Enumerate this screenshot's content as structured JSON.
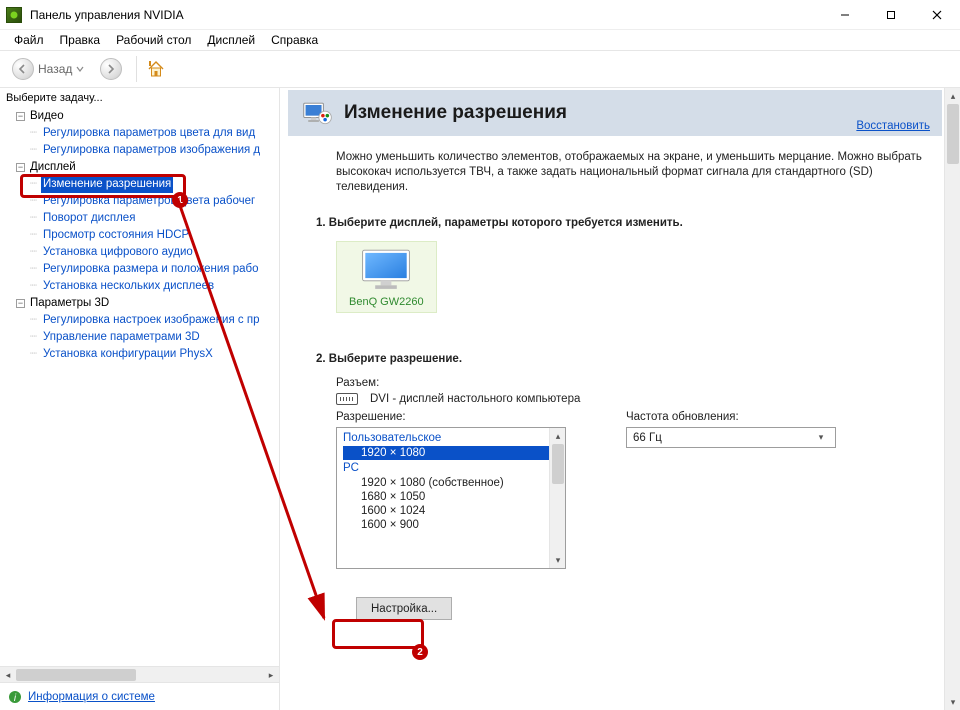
{
  "window": {
    "title": "Панель управления NVIDIA"
  },
  "menu": {
    "file": "Файл",
    "edit": "Правка",
    "desktop": "Рабочий стол",
    "display": "Дисплей",
    "help": "Справка"
  },
  "toolbar": {
    "back": "Назад"
  },
  "sidebar": {
    "task_label": "Выберите задачу...",
    "cat_video": "Видео",
    "video_items": {
      "i0": "Регулировка параметров цвета для вид",
      "i1": "Регулировка параметров изображения д"
    },
    "cat_display": "Дисплей",
    "display_items": {
      "i0": "Изменение разрешения",
      "i1": "Регулировка параметров цвета рабочег",
      "i2": "Поворот дисплея",
      "i3": "Просмотр состояния HDCP",
      "i4": "Установка цифрового аудио",
      "i5": "Регулировка размера и положения рабо",
      "i6": "Установка нескольких дисплеев"
    },
    "cat_3d": "Параметры 3D",
    "d3_items": {
      "i0": "Регулировка настроек изображения с пр",
      "i1": "Управление параметрами 3D",
      "i2": "Установка конфигурации PhysX"
    },
    "sysinfo": "Информация о системе"
  },
  "page": {
    "title": "Изменение разрешения",
    "restore": "Восстановить",
    "intro": "Можно уменьшить количество элементов, отображаемых на экране, и уменьшить мерцание. Можно выбрать высококач используется ТВЧ, а также задать национальный формат сигнала для стандартного (SD) телевидения.",
    "step1_h": "1. Выберите дисплей, параметры которого требуется изменить.",
    "monitor_name": "BenQ GW2260",
    "step2_h": "2. Выберите разрешение.",
    "connector_label": "Разъем:",
    "connector_value": "DVI - дисплей настольного компьютера",
    "resolution_label": "Разрешение:",
    "refresh_label": "Частота обновления:",
    "refresh_value": "66 Гц",
    "group_custom": "Пользовательское",
    "group_pc": "PC",
    "resolutions": {
      "r0": "1920 × 1080",
      "r1": "1920 × 1080 (собственное)",
      "r2": "1680 × 1050",
      "r3": "1600 × 1024",
      "r4": "1600 × 900"
    },
    "customize_btn": "Настройка..."
  },
  "annotations": {
    "n1": "1",
    "n2": "2"
  }
}
